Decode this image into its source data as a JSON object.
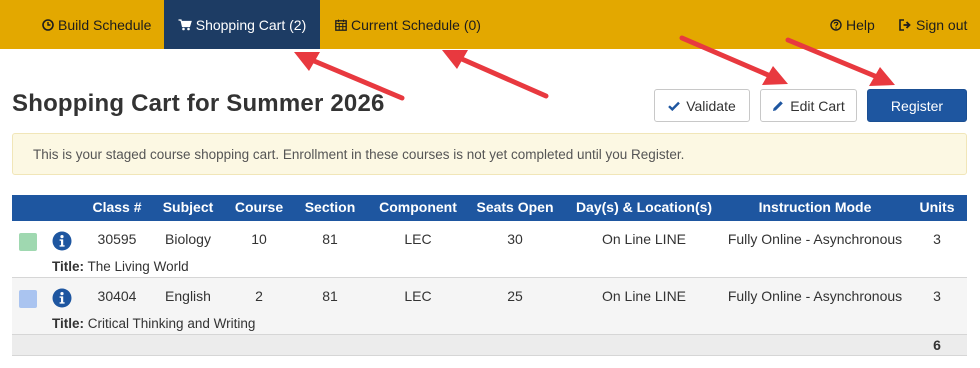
{
  "nav": {
    "build_schedule": "Build Schedule",
    "shopping_cart": "Shopping Cart (2)",
    "current_schedule": "Current Schedule (0)",
    "help": "Help",
    "sign_out": "Sign out"
  },
  "page": {
    "title": "Shopping Cart for Summer 2026"
  },
  "buttons": {
    "validate": "Validate",
    "edit_cart": "Edit Cart",
    "register": "Register"
  },
  "alert": {
    "text": "This is your staged course shopping cart. Enrollment in these courses is not yet completed until you Register."
  },
  "table": {
    "headers": [
      "Class #",
      "Subject",
      "Course",
      "Section",
      "Component",
      "Seats Open",
      "Day(s) & Location(s)",
      "Instruction Mode",
      "Units"
    ],
    "title_label": "Title:",
    "rows": [
      {
        "class_num": "30595",
        "subject": "Biology",
        "course": "10",
        "section": "81",
        "component": "LEC",
        "seats_open": "30",
        "days_location": "On Line LINE",
        "instruction_mode": "Fully Online - Asynchronous",
        "units": "3",
        "title": "The Living World",
        "swatch_color": "#9fd8b0"
      },
      {
        "class_num": "30404",
        "subject": "English",
        "course": "2",
        "section": "81",
        "component": "LEC",
        "seats_open": "25",
        "days_location": "On Line LINE",
        "instruction_mode": "Fully Online - Asynchronous",
        "units": "3",
        "title": "Critical Thinking and Writing",
        "swatch_color": "#aac4f0"
      }
    ],
    "total_units": "6"
  },
  "colors": {
    "nav_bg": "#e3a800",
    "nav_active": "#1d3c64",
    "primary": "#1e56a0",
    "annotation_arrow": "#e8393f"
  },
  "icons": {
    "build_schedule": "clock-icon",
    "shopping_cart": "cart-icon",
    "current_schedule": "calendar-icon",
    "help": "question-circle-icon",
    "sign_out": "sign-out-icon",
    "validate": "check-icon",
    "edit_cart": "pencil-icon",
    "row_info": "info-circle-icon"
  }
}
